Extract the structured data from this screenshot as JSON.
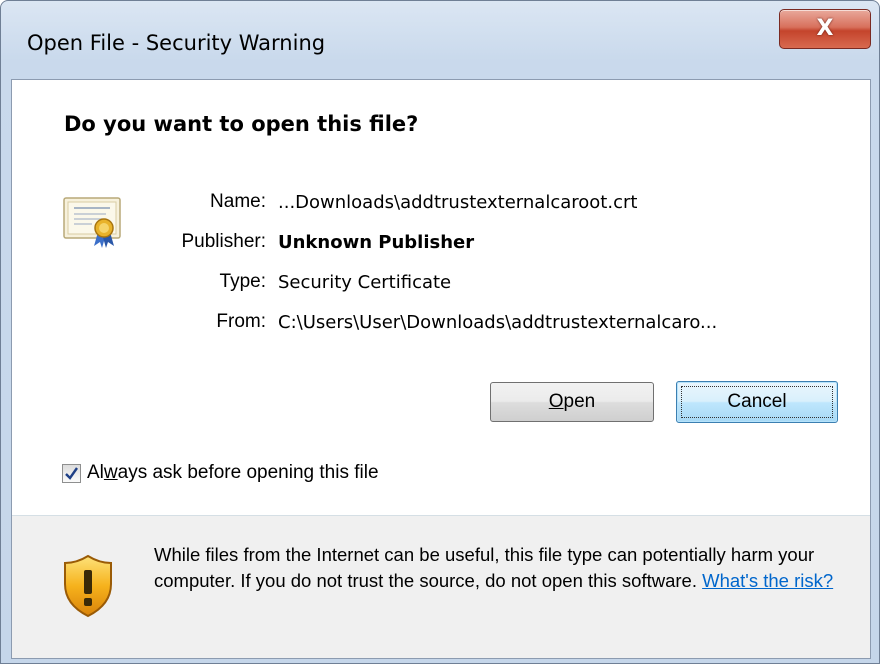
{
  "window": {
    "title": "Open File - Security Warning",
    "close_symbol": "X"
  },
  "prompt": {
    "question": "Do you want to open this file?"
  },
  "file_info": {
    "name_label": "Name:",
    "name_value": "...Downloads\\addtrustexternalcaroot.crt",
    "publisher_label": "Publisher:",
    "publisher_value": "Unknown Publisher",
    "type_label": "Type:",
    "type_value": "Security Certificate",
    "from_label": "From:",
    "from_value": "C:\\Users\\User\\Downloads\\addtrustexternalcaro..."
  },
  "buttons": {
    "open_mnemonic": "O",
    "open_rest": "pen",
    "cancel_label": "Cancel"
  },
  "checkbox": {
    "checked": true,
    "label_pre": "Al",
    "label_mnemonic": "w",
    "label_post": "ays ask before opening this file"
  },
  "warning": {
    "text": "While files from the Internet can be useful, this file type can potentially harm your computer. If you do not trust the source, do not open this software. ",
    "link_text": "What's the risk?"
  },
  "icons": {
    "certificate": "certificate-icon",
    "shield": "shield-warning-icon",
    "close": "close-icon",
    "checkmark": "checkmark-icon"
  },
  "colors": {
    "link": "#0066cc",
    "close_button": "#c4442c",
    "warning_background": "#f0f0f0"
  }
}
